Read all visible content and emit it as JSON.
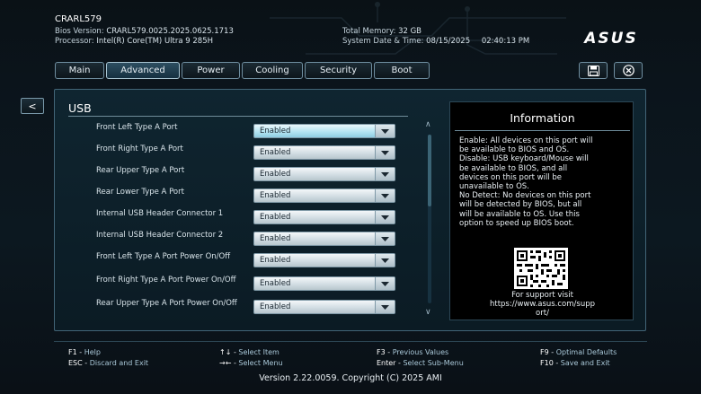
{
  "header": {
    "model": "CRARL579",
    "bios_label": "Bios Version:",
    "bios_value": "CRARL579.0025.2025.0625.1713",
    "processor_label": "Processor:",
    "processor_value": "Intel(R) Core(TM) Ultra 9 285H",
    "memory_label": "Total Memory:",
    "memory_value": "32 GB",
    "datetime_label": "System Date & Time:",
    "date_value": "08/15/2025",
    "time_value": "02:40:13 PM",
    "logo_text": "ASUS"
  },
  "tabs": [
    {
      "label": "Main"
    },
    {
      "label": "Advanced"
    },
    {
      "label": "Power"
    },
    {
      "label": "Cooling"
    },
    {
      "label": "Security"
    },
    {
      "label": "Boot"
    }
  ],
  "active_tab": "Advanced",
  "toolbar": {
    "save_icon": "save-icon",
    "exit_icon": "close-circle-icon"
  },
  "back_label": "<",
  "section_title": "USB",
  "settings": [
    {
      "label": "Front Left Type A Port",
      "value": "Enabled"
    },
    {
      "label": "Front Right Type A Port",
      "value": "Enabled"
    },
    {
      "label": "Rear Upper Type A Port",
      "value": "Enabled"
    },
    {
      "label": "Rear Lower Type A Port",
      "value": "Enabled"
    },
    {
      "label": "Internal USB Header Connector 1",
      "value": "Enabled"
    },
    {
      "label": "Internal USB Header Connector 2",
      "value": "Enabled"
    },
    {
      "label": "Front Left Type A Port Power On/Off",
      "value": "Enabled"
    },
    {
      "label": "Front Right Type A Port Power On/Off",
      "value": "Enabled"
    },
    {
      "label": "Rear Upper Type A Port Power On/Off",
      "value": "Enabled"
    }
  ],
  "scroll": {
    "up": "∧",
    "down": "∨"
  },
  "info": {
    "title": "Information",
    "lines": [
      "Enable: All devices on this port will",
      "be available to BIOS and OS.",
      "Disable: USB keyboard/Mouse will",
      "be available to BIOS, and all",
      "devices on this port will be",
      "unavailable to OS.",
      "No Detect: No devices on this port",
      "will be detected by BIOS, but all",
      "will be available to OS. Use this",
      "option to speed up BIOS boot."
    ],
    "support_lines": [
      "For support visit",
      "https://www.asus.com/supp",
      "ort/"
    ]
  },
  "help": [
    {
      "key": "F1",
      "desc": "Help"
    },
    {
      "key": "ESC",
      "desc": "Discard and Exit"
    },
    {
      "key": "↑↓",
      "desc": "Select Item"
    },
    {
      "key": "→←",
      "desc": "Select Menu"
    },
    {
      "key": "F3",
      "desc": "Previous Values"
    },
    {
      "key": "Enter",
      "desc": "Select Sub-Menu"
    },
    {
      "key": "F9",
      "desc": "Optimal Defaults"
    },
    {
      "key": "F10",
      "desc": "Save and Exit"
    }
  ],
  "version": "Version 2.22.0059. Copyright (C) 2025 AMI",
  "colors": {
    "accent": "#8fcde2",
    "panel": "#0f2530"
  }
}
